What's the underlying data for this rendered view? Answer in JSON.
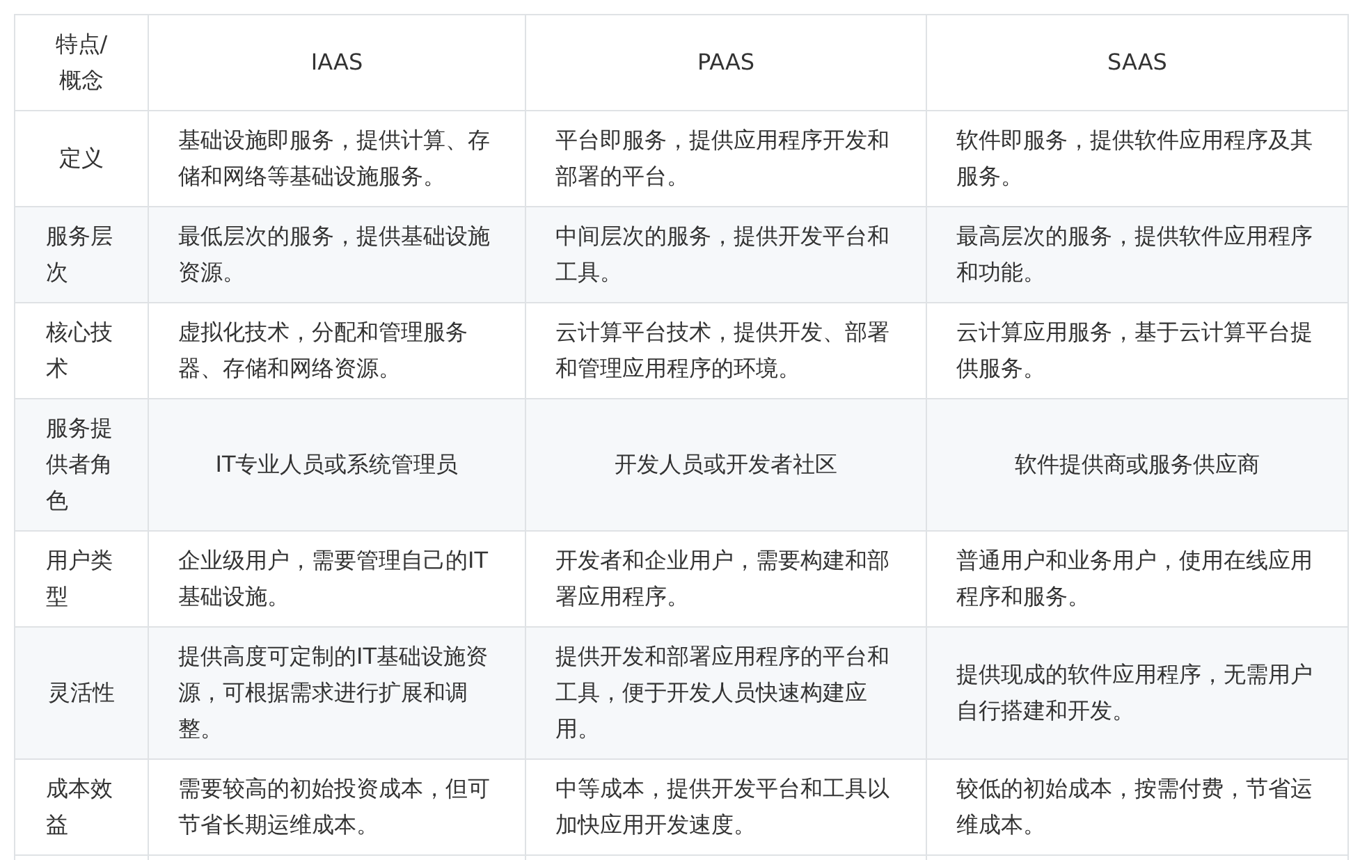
{
  "table": {
    "columns": [
      "特点/概念",
      "IAAS",
      "PAAS",
      "SAAS"
    ],
    "rows": [
      {
        "cells": [
          "定义",
          "基础设施即服务，提供计算、存储和网络等基础设施服务。",
          "平台即服务，提供应用程序开发和部署的平台。",
          "软件即服务，提供软件应用程序及其服务。"
        ]
      },
      {
        "cells": [
          "服务层次",
          "最低层次的服务，提供基础设施资源。",
          "中间层次的服务，提供开发平台和工具。",
          "最高层次的服务，提供软件应用程序和功能。"
        ]
      },
      {
        "cells": [
          "核心技术",
          "虚拟化技术，分配和管理服务器、存储和网络资源。",
          "云计算平台技术，提供开发、部署和管理应用程序的环境。",
          "云计算应用服务，基于云计算平台提供服务。"
        ]
      },
      {
        "cells": [
          "服务提供者角色",
          "IT专业人员或系统管理员",
          "开发人员或开发者社区",
          "软件提供商或服务供应商"
        ]
      },
      {
        "cells": [
          "用户类型",
          "企业级用户，需要管理自己的IT基础设施。",
          "开发者和企业用户，需要构建和部署应用程序。",
          "普通用户和业务用户，使用在线应用程序和服务。"
        ]
      },
      {
        "cells": [
          "灵活性",
          "提供高度可定制的IT基础设施资源，可根据需求进行扩展和调整。",
          "提供开发和部署应用程序的平台和工具，便于开发人员快速构建应用。",
          "提供现成的软件应用程序，无需用户自行搭建和开发。"
        ]
      },
      {
        "cells": [
          "成本效益",
          "需要较高的初始投资成本，但可节省长期运维成本。",
          "中等成本，提供开发平台和工具以加快应用开发速度。",
          "较低的初始成本，按需付费，节省运维成本。"
        ]
      }
    ]
  }
}
